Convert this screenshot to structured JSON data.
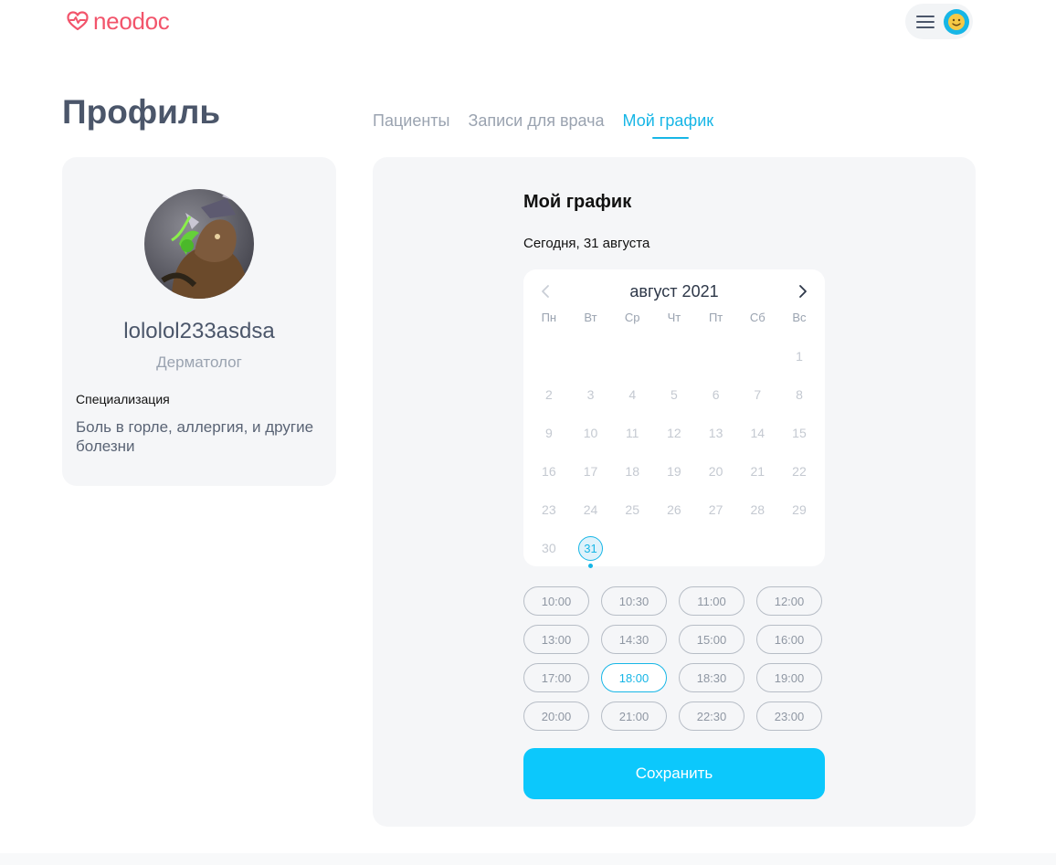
{
  "header": {
    "logo_text": "neodoc",
    "logo_icon": "heart-pulse-icon",
    "menu_icon": "hamburger-icon",
    "avatar_icon": "smiley-icon",
    "brand_color": "#f2546b",
    "accent_color": "#17b6e6"
  },
  "page": {
    "title": "Профиль"
  },
  "tabs": [
    {
      "label": "Пациенты",
      "active": false
    },
    {
      "label": "Записи для врача",
      "active": false
    },
    {
      "label": "Мой график",
      "active": true
    }
  ],
  "profile": {
    "name": "lololol233asdsa",
    "role": "Дерматолог",
    "specialization_label": "Специализация",
    "specialization_value": "Боль в горле, аллергия, и другие болезни"
  },
  "schedule": {
    "title": "Мой график",
    "today": "Сегодня, 31 августа",
    "calendar": {
      "month_label": "август 2021",
      "weekdays": [
        "Пн",
        "Вт",
        "Ср",
        "Чт",
        "Пт",
        "Сб",
        "Вс"
      ],
      "leading_blanks": 6,
      "days": [
        "1",
        "2",
        "3",
        "4",
        "5",
        "6",
        "7",
        "8",
        "9",
        "10",
        "11",
        "12",
        "13",
        "14",
        "15",
        "16",
        "17",
        "18",
        "19",
        "20",
        "21",
        "22",
        "23",
        "24",
        "25",
        "26",
        "27",
        "28",
        "29",
        "30",
        "31"
      ],
      "selected_day": "31"
    },
    "time_slots": [
      {
        "label": "10:00",
        "active": false
      },
      {
        "label": "10:30",
        "active": false
      },
      {
        "label": "11:00",
        "active": false
      },
      {
        "label": "12:00",
        "active": false
      },
      {
        "label": "13:00",
        "active": false
      },
      {
        "label": "14:30",
        "active": false
      },
      {
        "label": "15:00",
        "active": false
      },
      {
        "label": "16:00",
        "active": false
      },
      {
        "label": "17:00",
        "active": false
      },
      {
        "label": "18:00",
        "active": true
      },
      {
        "label": "18:30",
        "active": false
      },
      {
        "label": "19:00",
        "active": false
      },
      {
        "label": "20:00",
        "active": false
      },
      {
        "label": "21:00",
        "active": false
      },
      {
        "label": "22:30",
        "active": false
      },
      {
        "label": "23:00",
        "active": false
      }
    ],
    "save_label": "Сохранить"
  }
}
